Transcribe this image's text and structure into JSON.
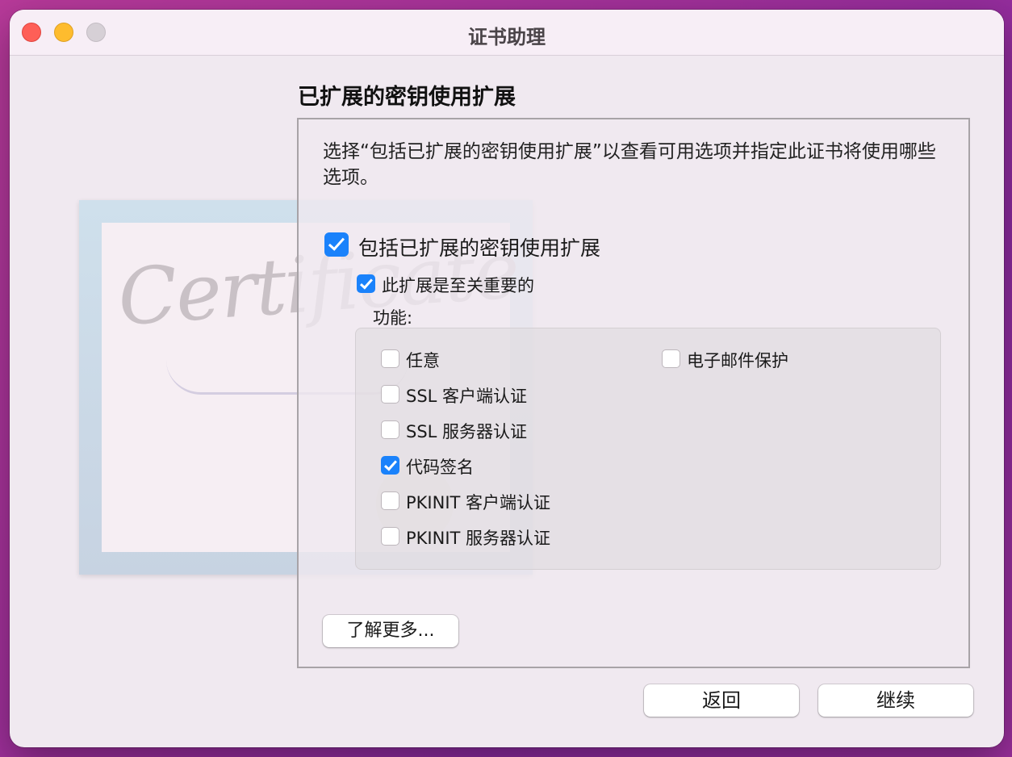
{
  "window": {
    "title": "证书助理"
  },
  "decoration": {
    "certificate_word": "Certificate"
  },
  "section_heading": "已扩展的密钥使用扩展",
  "description": "选择“包括已扩展的密钥使用扩展”以查看可用选项并指定此证书将使用哪些选项。",
  "include_extension": {
    "label": "包括已扩展的密钥使用扩展",
    "checked": true
  },
  "critical_extension": {
    "label": "此扩展是至关重要的",
    "checked": true
  },
  "capabilities": {
    "label": "功能:",
    "left_column": [
      {
        "label": "任意",
        "checked": false
      },
      {
        "label": "SSL 客户端认证",
        "checked": false
      },
      {
        "label": "SSL 服务器认证",
        "checked": false
      },
      {
        "label": "代码签名",
        "checked": true
      },
      {
        "label": "PKINIT 客户端认证",
        "checked": false
      },
      {
        "label": "PKINIT 服务器认证",
        "checked": false
      }
    ],
    "right_column": [
      {
        "label": "电子邮件保护",
        "checked": false
      }
    ]
  },
  "learn_more_button": "了解更多...",
  "back_button": "返回",
  "continue_button": "继续",
  "colors": {
    "accent": "#1a82fb",
    "close": "#fe5f57",
    "minimize": "#febc2e",
    "zoom_inactive": "#d6d0d6"
  }
}
